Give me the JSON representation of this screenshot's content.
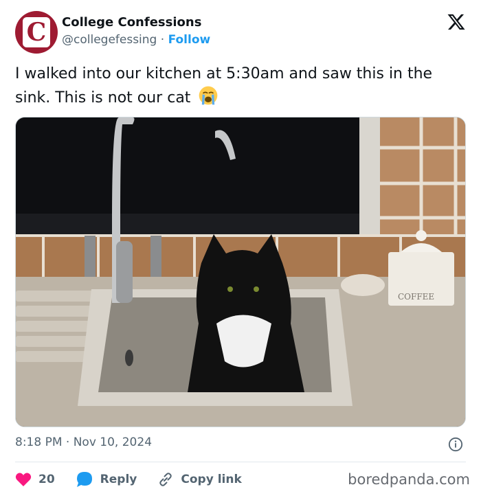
{
  "account": {
    "avatar_letter": "C",
    "name": "College Confessions",
    "handle": "@collegefessing",
    "separator": "·",
    "follow_label": "Follow"
  },
  "tweet": {
    "text": "I walked into our kitchen at 5:30am and saw this in the sink. This is not our cat",
    "emoji": "loudly-crying-face-icon",
    "photo_caption_on_jar": "COFFEE"
  },
  "meta": {
    "time": "8:18 PM",
    "separator": "·",
    "date": "Nov 10, 2024"
  },
  "actions": {
    "like_count": "20",
    "reply_label": "Reply",
    "copy_label": "Copy link"
  },
  "watermark": "boredpanda.com",
  "colors": {
    "brand_red": "#9e1b32",
    "link_blue": "#1d9bf0",
    "like_pink": "#f91880",
    "muted_gray": "#536471"
  }
}
